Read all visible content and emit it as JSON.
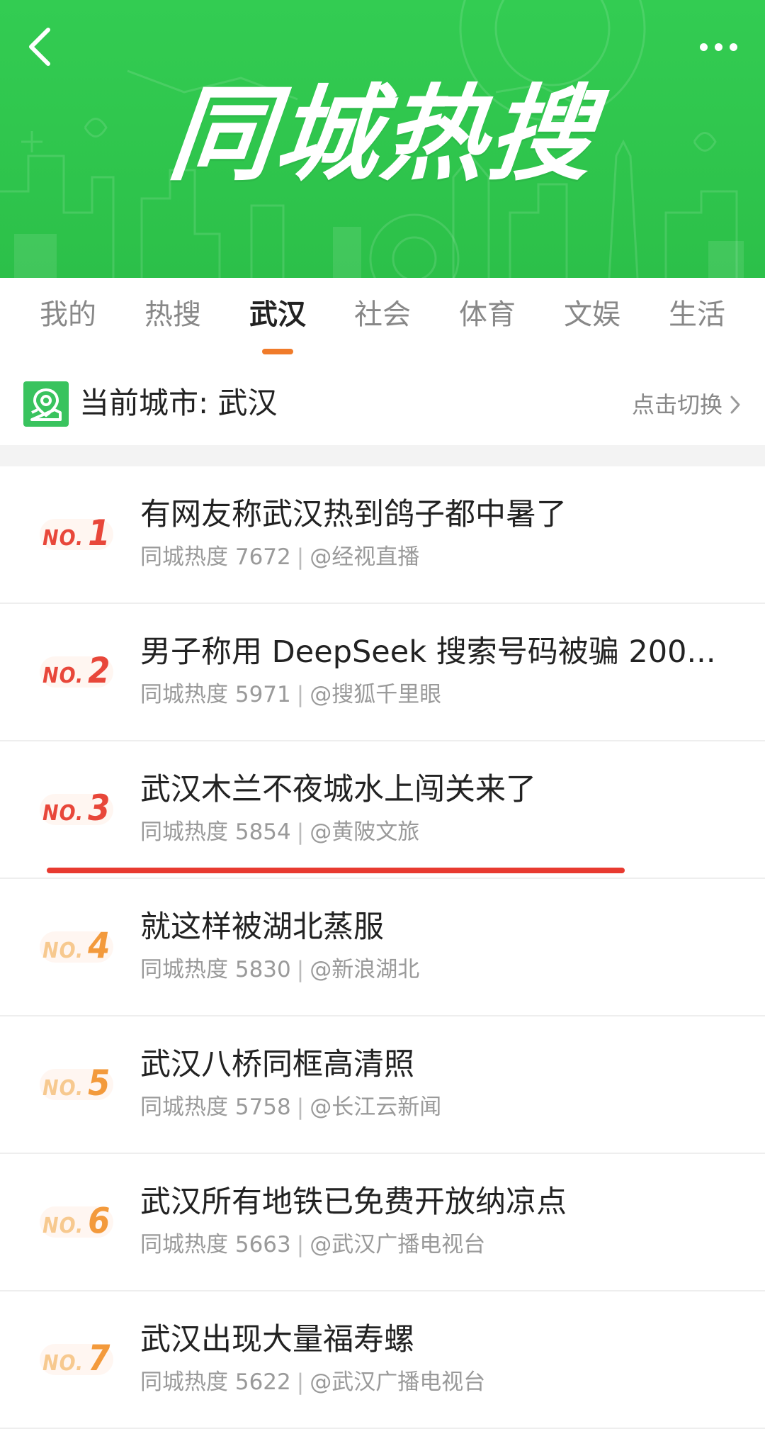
{
  "header": {
    "title": "同城热搜",
    "back_icon": "chevron-left-icon",
    "more_icon": "more-horizontal-icon",
    "color": "#2ec24b"
  },
  "tabs": [
    {
      "label": "我的",
      "active": false
    },
    {
      "label": "热搜",
      "active": false
    },
    {
      "label": "武汉",
      "active": true
    },
    {
      "label": "社会",
      "active": false
    },
    {
      "label": "体育",
      "active": false
    },
    {
      "label": "文娱",
      "active": false
    },
    {
      "label": "生活",
      "active": false
    }
  ],
  "tab_accent": "#f07b2a",
  "city": {
    "label": "当前城市: 武汉",
    "switch_label": "点击切换",
    "icon": "map-location-icon"
  },
  "list": [
    {
      "no": "NO.",
      "rank": "1",
      "title": "有网友称武汉热到鸽子都中暑了",
      "heat": "同城热度 7672",
      "source": "@经视直播"
    },
    {
      "no": "NO.",
      "rank": "2",
      "title": "男子称用 DeepSeek 搜索号码被骗 200...",
      "heat": "同城热度 5971",
      "source": "@搜狐千里眼"
    },
    {
      "no": "NO.",
      "rank": "3",
      "title": "武汉木兰不夜城水上闯关来了",
      "heat": "同城热度 5854",
      "source": "@黄陂文旅"
    },
    {
      "no": "NO.",
      "rank": "4",
      "title": "就这样被湖北蒸服",
      "heat": "同城热度 5830",
      "source": "@新浪湖北"
    },
    {
      "no": "NO.",
      "rank": "5",
      "title": "武汉八桥同框高清照",
      "heat": "同城热度 5758",
      "source": "@长江云新闻"
    },
    {
      "no": "NO.",
      "rank": "6",
      "title": "武汉所有地铁已免费开放纳凉点",
      "heat": "同城热度 5663",
      "source": "@武汉广播电视台"
    },
    {
      "no": "NO.",
      "rank": "7",
      "title": "武汉出现大量福寿螺",
      "heat": "同城热度 5622",
      "source": "@武汉广播电视台"
    }
  ],
  "colors": {
    "top_rank": "#e8473a",
    "other_rank": "#f39a3c",
    "highlight_line": "#e83a30"
  }
}
